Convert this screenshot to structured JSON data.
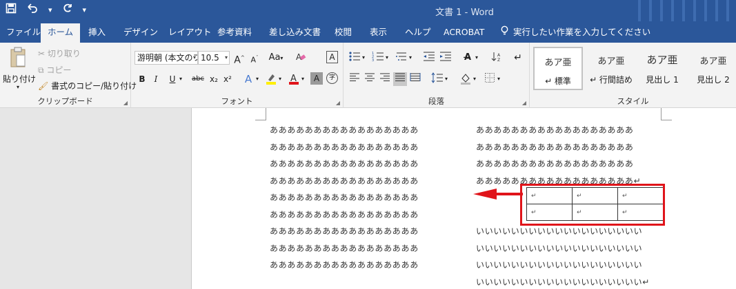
{
  "window": {
    "title": "文書 1  -  Word"
  },
  "qat": {
    "save_icon": "save-icon",
    "undo_icon": "undo-icon",
    "redo_icon": "redo-icon",
    "customize_icon": "customize-icon"
  },
  "tabs": [
    {
      "label": "ファイル",
      "active": false
    },
    {
      "label": "ホーム",
      "active": true
    },
    {
      "label": "挿入",
      "active": false
    },
    {
      "label": "デザイン",
      "active": false
    },
    {
      "label": "レイアウト",
      "active": false
    },
    {
      "label": "参考資料",
      "active": false
    },
    {
      "label": "差し込み文書",
      "active": false
    },
    {
      "label": "校閲",
      "active": false
    },
    {
      "label": "表示",
      "active": false
    },
    {
      "label": "ヘルプ",
      "active": false
    },
    {
      "label": "ACROBAT",
      "active": false
    }
  ],
  "tell_me": {
    "placeholder": "実行したい作業を入力してください"
  },
  "clipboard": {
    "group_label": "クリップボード",
    "paste_label": "貼り付け",
    "cut_label": "切り取り",
    "copy_label": "コピー",
    "format_painter_label": "書式のコピー/貼り付け"
  },
  "font": {
    "group_label": "フォント",
    "font_name": "游明朝 (本文のフォ",
    "font_size": "10.5",
    "grow_label": "A",
    "shrink_label": "A",
    "case_label": "Aa",
    "bold": "B",
    "italic": "I",
    "underline": "U",
    "strike": "abc",
    "subscript": "x₂",
    "superscript": "x²",
    "phonetic": "字"
  },
  "paragraph": {
    "group_label": "段落"
  },
  "styles": {
    "group_label": "スタイル",
    "items": [
      {
        "sample": "あア亜",
        "name": "↵ 標準"
      },
      {
        "sample": "あア亜",
        "name": "↵ 行間詰め"
      },
      {
        "sample": "あア亜",
        "name": "見出し 1"
      },
      {
        "sample": "あア亜",
        "name": "見出し 2"
      }
    ]
  },
  "document": {
    "left_column": [
      "あああああああああああああああああ",
      "あああああああああああああああああ",
      "あああああああああああああああああ",
      "あああああああああああああああああ",
      "あああああああああああああああああ",
      "あああああああああああああああああ",
      "あああああああああああああああああ",
      "あああああああああああああああああ",
      "あああああああああああああああああ"
    ],
    "right_column_top": [
      "ああああああああああああああああああ",
      "ああああああああああああああああああ",
      "ああああああああああああああああああ",
      "ああああああああああああああああああ↵"
    ],
    "right_column_bottom": [
      "いいいいいいいいいいいいいいいいいいい",
      "いいいいいいいいいいいいいいいいいいい",
      "いいいいいいいいいいいいいいいいいいい",
      "いいいいいいいいいいいいいいいいいいい↵"
    ],
    "table": [
      [
        "↵",
        "↵",
        "↵"
      ],
      [
        "↵",
        "↵",
        "↵"
      ]
    ],
    "annotation_color": "#e0141a"
  }
}
